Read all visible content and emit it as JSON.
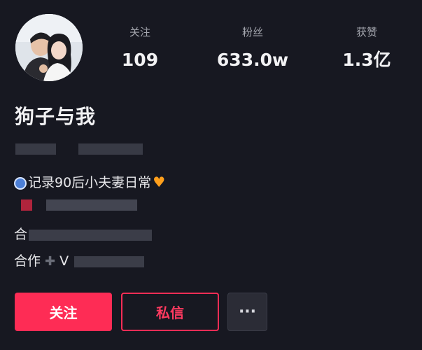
{
  "profile": {
    "name": "狗子与我",
    "avatar_icon": "couple-avatar-photo"
  },
  "stats": {
    "following_label": "关注",
    "following_value": "109",
    "followers_label": "粉丝",
    "followers_value": "633.0w",
    "likes_label": "获赞",
    "likes_value": "1.3亿"
  },
  "bio": {
    "line1": "记录90后小夫妻日常",
    "line1_icon": "camera-icon",
    "line1_emoji": "orange-heart-icon",
    "line2_prefix": "合",
    "line3_prefix": "合作",
    "line3_icon": "plus-icon",
    "line3_partial": "V"
  },
  "actions": {
    "follow_label": "关注",
    "message_label": "私信",
    "more_label": "···"
  },
  "colors": {
    "background": "#171821",
    "accent": "#fe2c55",
    "secondary_text": "#a4a6ae"
  }
}
